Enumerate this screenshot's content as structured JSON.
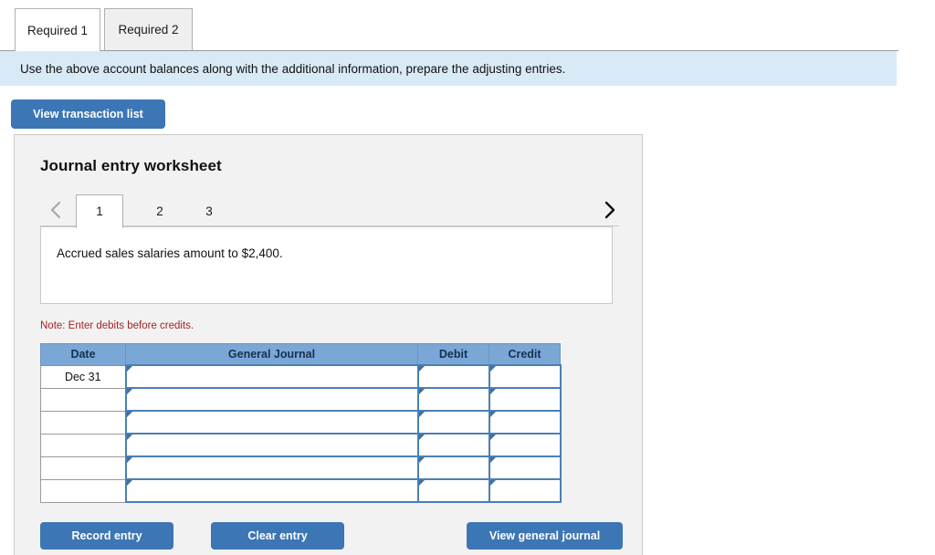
{
  "tabs": {
    "items": [
      {
        "label": "Required 1",
        "active": true
      },
      {
        "label": "Required 2",
        "active": false
      }
    ]
  },
  "banner": {
    "text": "Use the above account balances along with the additional information, prepare the adjusting entries."
  },
  "toolbar": {
    "view_transaction_list_label": "View transaction list"
  },
  "worksheet": {
    "title": "Journal entry worksheet",
    "pager": {
      "prev_icon": "chevron-left-icon",
      "next_icon": "chevron-right-icon",
      "pages": [
        {
          "label": "1",
          "active": true
        },
        {
          "label": "2",
          "active": false
        },
        {
          "label": "3",
          "active": false
        }
      ]
    },
    "prompt": "Accrued sales salaries amount to $2,400.",
    "note": "Note: Enter debits before credits.",
    "table": {
      "headers": [
        "Date",
        "General Journal",
        "Debit",
        "Credit"
      ],
      "rows": [
        {
          "date": "Dec 31",
          "general_journal": "",
          "debit": "",
          "credit": ""
        },
        {
          "date": "",
          "general_journal": "",
          "debit": "",
          "credit": ""
        },
        {
          "date": "",
          "general_journal": "",
          "debit": "",
          "credit": ""
        },
        {
          "date": "",
          "general_journal": "",
          "debit": "",
          "credit": ""
        },
        {
          "date": "",
          "general_journal": "",
          "debit": "",
          "credit": ""
        },
        {
          "date": "",
          "general_journal": "",
          "debit": "",
          "credit": ""
        }
      ]
    },
    "actions": {
      "record_entry_label": "Record entry",
      "clear_entry_label": "Clear entry",
      "view_general_journal_label": "View general journal"
    }
  },
  "colors": {
    "button_blue": "#3d76b4",
    "banner_blue": "#d9eaf7",
    "table_header_blue": "#7ba7d7",
    "cell_border_blue": "#4a7fb5",
    "note_red": "#a62222",
    "panel_gray": "#f2f2f2"
  }
}
